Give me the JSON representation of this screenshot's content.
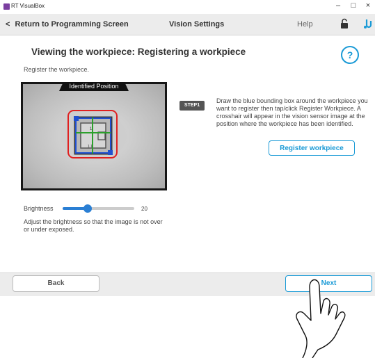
{
  "window": {
    "app_title": "RT VisualBox",
    "controls": {
      "minimize": "–",
      "maximize": "□",
      "close": "×"
    }
  },
  "header": {
    "back_label": "Return to Programming Screen",
    "back_arrow": "<",
    "title": "Vision Settings",
    "help_label": "Help"
  },
  "main": {
    "heading": "Viewing the workpiece: Registering a workpiece",
    "subheading": "Register the workpiece.",
    "help_icon_glyph": "?",
    "camera": {
      "overlay_label": "Identified Position",
      "part_text_a": "1",
      "part_text_b": "1 1"
    },
    "step": {
      "badge": "STEP1",
      "text": "Draw the blue bounding box around the workpiece you want to register then tap/click Register Workpiece. A crosshair will appear in the vision sensor image at the position where the workpiece has been identified.",
      "register_button": "Register workpiece"
    },
    "brightness": {
      "label": "Brightness",
      "value": "20",
      "fraction": 0.35,
      "help": "Adjust the brightness so that the image is not over or under exposed."
    }
  },
  "footer": {
    "back_button": "Back",
    "next_button": "Next"
  },
  "colors": {
    "accent": "#1a9ad6",
    "slider": "#2a7fd4",
    "bbox_red": "#e02020",
    "bbox_blue": "#2050d0",
    "crosshair": "#2ca02c",
    "header_bg": "#ececec"
  }
}
